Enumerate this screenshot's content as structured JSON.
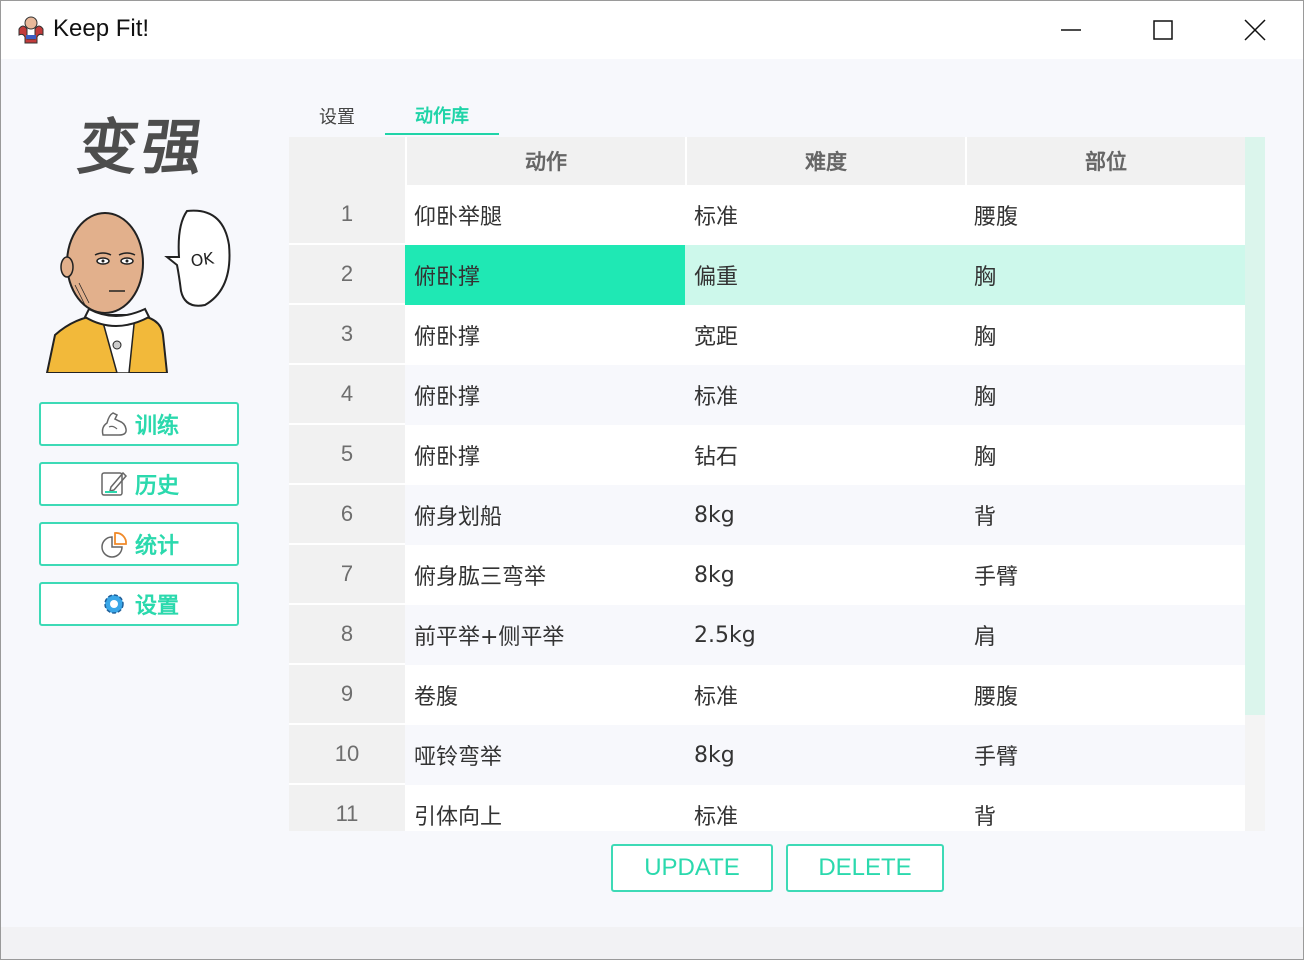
{
  "window": {
    "title": "Keep Fit!",
    "icon": "muscle-man-icon",
    "controls": [
      "minimize-icon",
      "maximize-icon",
      "close-icon"
    ]
  },
  "sidebar": {
    "logo_text": "变强",
    "avatar_speech": "OK",
    "nav": [
      {
        "label": "训练",
        "icon": "muscle-arm-icon"
      },
      {
        "label": "历史",
        "icon": "edit-note-icon"
      },
      {
        "label": "统计",
        "icon": "pie-chart-icon"
      },
      {
        "label": "设置",
        "icon": "gear-icon"
      }
    ]
  },
  "tabs": [
    {
      "label": "设置",
      "active": false
    },
    {
      "label": "动作库",
      "active": true
    }
  ],
  "table": {
    "columns": [
      "动作",
      "难度",
      "部位"
    ],
    "selected_row": 2,
    "rows": [
      {
        "n": "1",
        "action": "仰卧举腿",
        "difficulty": "标准",
        "part": "腰腹"
      },
      {
        "n": "2",
        "action": "俯卧撑",
        "difficulty": "偏重",
        "part": "胸"
      },
      {
        "n": "3",
        "action": "俯卧撑",
        "difficulty": "宽距",
        "part": "胸"
      },
      {
        "n": "4",
        "action": "俯卧撑",
        "difficulty": "标准",
        "part": "胸"
      },
      {
        "n": "5",
        "action": "俯卧撑",
        "difficulty": "钻石",
        "part": "胸"
      },
      {
        "n": "6",
        "action": "俯身划船",
        "difficulty": "8kg",
        "part": "背"
      },
      {
        "n": "7",
        "action": "俯身肱三弯举",
        "difficulty": "8kg",
        "part": "手臂"
      },
      {
        "n": "8",
        "action": "前平举+侧平举",
        "difficulty": "2.5kg",
        "part": "肩"
      },
      {
        "n": "9",
        "action": "卷腹",
        "difficulty": "标准",
        "part": "腰腹"
      },
      {
        "n": "10",
        "action": "哑铃弯举",
        "difficulty": "8kg",
        "part": "手臂"
      },
      {
        "n": "11",
        "action": "引体向上",
        "difficulty": "标准",
        "part": "背"
      }
    ]
  },
  "actions": {
    "update_label": "UPDATE",
    "delete_label": "DELETE"
  },
  "colors": {
    "accent": "#2bd9ad",
    "selected_cell": "#1fe8b4",
    "selected_row": "#cdf8eb"
  }
}
